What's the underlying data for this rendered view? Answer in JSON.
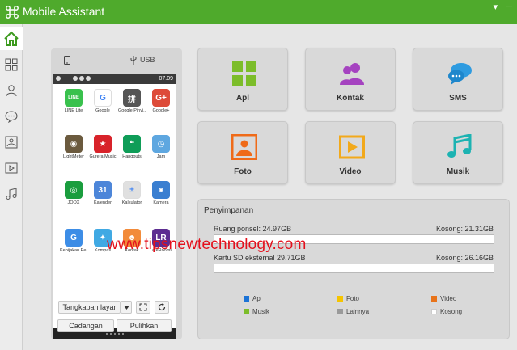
{
  "app": {
    "title": "Mobile Assistant",
    "minimize": "▾",
    "close": "─"
  },
  "sidebar": {
    "items": [
      {
        "icon": "home-icon"
      },
      {
        "icon": "grid-icon"
      },
      {
        "icon": "user-icon"
      },
      {
        "icon": "chat-icon"
      },
      {
        "icon": "image-icon"
      },
      {
        "icon": "video-icon"
      },
      {
        "icon": "music-icon"
      }
    ]
  },
  "phone": {
    "usb_label": "USB",
    "clock": "07.09",
    "apps": [
      {
        "label": "LINE Lite",
        "glyph": "LINE",
        "color": "#39c14d"
      },
      {
        "label": "Google",
        "glyph": "G",
        "color": "#ffffff"
      },
      {
        "label": "Google Pinyi..",
        "glyph": "拼",
        "color": "#555555"
      },
      {
        "label": "Google+",
        "glyph": "G+",
        "color": "#dd4b39"
      },
      {
        "label": "LightMeter",
        "glyph": "◉",
        "color": "#6b5a3e"
      },
      {
        "label": "Gurera Music",
        "glyph": "★",
        "color": "#d8232a"
      },
      {
        "label": "Hangouts",
        "glyph": "❝",
        "color": "#0f9d58"
      },
      {
        "label": "Jam",
        "glyph": "◷",
        "color": "#5ea7e0"
      },
      {
        "label": "JOOX",
        "glyph": "◎",
        "color": "#1a9d3e"
      },
      {
        "label": "Kalender",
        "glyph": "31",
        "color": "#4d86d9"
      },
      {
        "label": "Kalkulator",
        "glyph": "±",
        "color": "#e0e0e0"
      },
      {
        "label": "Kamera",
        "glyph": "◙",
        "color": "#3a7fd1"
      },
      {
        "label": "Kebijakan Pe..",
        "glyph": "G",
        "color": "#3d8de6"
      },
      {
        "label": "Kompas",
        "glyph": "✦",
        "color": "#40a9e3"
      },
      {
        "label": "Kontak",
        "glyph": "☻",
        "color": "#f28b3a"
      },
      {
        "label": "LateRooms",
        "glyph": "LR",
        "color": "#5d2d91"
      }
    ],
    "screenshot_button": "Tangkapan layar",
    "backup_button": "Cadangan",
    "restore_button": "Pulihkan"
  },
  "tiles": [
    {
      "label": "Apl",
      "icon": "apps-icon",
      "color": "#7cbd2a"
    },
    {
      "label": "Kontak",
      "icon": "contacts-icon",
      "color": "#a543c0"
    },
    {
      "label": "SMS",
      "icon": "sms-icon",
      "color": "#2e9be0"
    },
    {
      "label": "Foto",
      "icon": "photo-icon",
      "color": "#ef6a18"
    },
    {
      "label": "Video",
      "icon": "video-tile-icon",
      "color": "#f2a91b"
    },
    {
      "label": "Musik",
      "icon": "music-tile-icon",
      "color": "#1cb3b2"
    }
  ],
  "storage": {
    "heading": "Penyimpanan",
    "internal_label": "Ruang ponsel: 24.97GB",
    "internal_free": "Kosong: 21.31GB",
    "external_label": "Kartu SD eksternal 29.71GB",
    "external_free": "Kosong: 26.16GB",
    "legend": [
      {
        "label": "Apl",
        "color": "#1c73d6"
      },
      {
        "label": "Foto",
        "color": "#f5c400"
      },
      {
        "label": "Video",
        "color": "#e8731a"
      },
      {
        "label": "Musik",
        "color": "#7cbd2a"
      },
      {
        "label": "Lainnya",
        "color": "#9a9a9a"
      },
      {
        "label": "Kosong",
        "color": "#ffffff"
      }
    ]
  },
  "watermark": "www.tipsnewtechnology.com"
}
